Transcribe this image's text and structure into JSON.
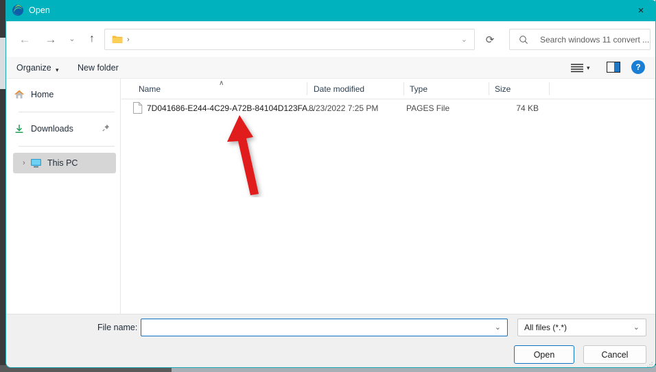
{
  "window": {
    "title": "Open",
    "app_icon": "edge-logo-icon",
    "close_label": "×",
    "titlebar_color": "#00b2bd",
    "border_color": "#17a9b4"
  },
  "navigation": {
    "back": "←",
    "forward": "→",
    "recent": "⌄",
    "up": "↑",
    "refresh": "⟳"
  },
  "address": {
    "folder_icon": "folder-icon",
    "separator": "›",
    "chevron": "⌄",
    "path_text": ""
  },
  "search": {
    "placeholder": "Search windows 11 convert ...",
    "icon": "search-icon"
  },
  "command_bar": {
    "organize": "Organize",
    "organize_caret": "▾",
    "new_folder": "New folder",
    "view_caret": "▾",
    "help_label": "?",
    "pane_accent": "#1f77c4"
  },
  "sidebar": {
    "items": [
      {
        "label": "Home",
        "icon": "home-icon",
        "selected": false,
        "pinned": false,
        "expandable": false
      },
      {
        "label": "Downloads",
        "icon": "download-icon",
        "selected": false,
        "pinned": true,
        "expandable": false
      },
      {
        "label": "This PC",
        "icon": "monitor-icon",
        "selected": true,
        "pinned": false,
        "expandable": true
      }
    ],
    "pin_glyph": "📌",
    "chevron_glyph": "›"
  },
  "file_list": {
    "columns": [
      {
        "label": "Name",
        "sorted": true,
        "sort_glyph": "∧"
      },
      {
        "label": "Date modified",
        "sorted": false,
        "sort_glyph": ""
      },
      {
        "label": "Type",
        "sorted": false,
        "sort_glyph": ""
      },
      {
        "label": "Size",
        "sorted": false,
        "sort_glyph": ""
      }
    ],
    "rows": [
      {
        "name": "7D041686-E244-4C29-A72B-84104D123FA...",
        "date_modified": "8/23/2022 7:25 PM",
        "type": "PAGES File",
        "size": "74 KB",
        "icon": "document-icon"
      }
    ]
  },
  "footer": {
    "file_name_label": "File name:",
    "file_name_value": "",
    "file_name_caret": "⌄",
    "filter_value": "All files (*.*)",
    "filter_caret": "⌄",
    "open_button": "Open",
    "cancel_button": "Cancel"
  },
  "annotation": {
    "arrow_color": "#e01b1b",
    "points_at": "7D041686-E244-4C29-A72B-84104D123FA..."
  }
}
